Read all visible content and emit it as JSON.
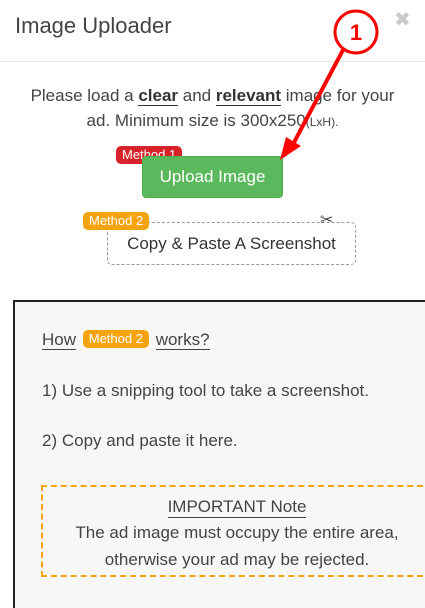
{
  "header": {
    "title": "Image Uploader",
    "close_icon": "close-icon"
  },
  "intro": {
    "line1_prefix": "Please load a ",
    "clear": "clear",
    "and": " and ",
    "relevant": "relevant",
    "line1_suffix": " image for your",
    "line2": "ad. Minimum size is 300x250",
    "units": "(LxH)."
  },
  "method1": {
    "badge": "Method 1",
    "button_label": "Upload Image"
  },
  "method2": {
    "badge": "Method 2",
    "button_label": "Copy & Paste A Screenshot",
    "icon": "scissors-icon"
  },
  "annotation": {
    "step_number": "1",
    "color": "#ff0000"
  },
  "panel": {
    "how_prefix": "How",
    "how_badge": "Method 2",
    "how_suffix": "works?",
    "step1": "1) Use a snipping tool to take a screenshot.",
    "step2": "2) Copy and paste it here.",
    "note_title": "IMPORTANT Note",
    "note_line1": "The ad image must occupy the entire area,",
    "note_line2": "otherwise your ad may be rejected."
  },
  "colors": {
    "upload_green": "#5cb85c",
    "method1_red": "#d9232a",
    "method2_orange": "#f5a30f"
  }
}
